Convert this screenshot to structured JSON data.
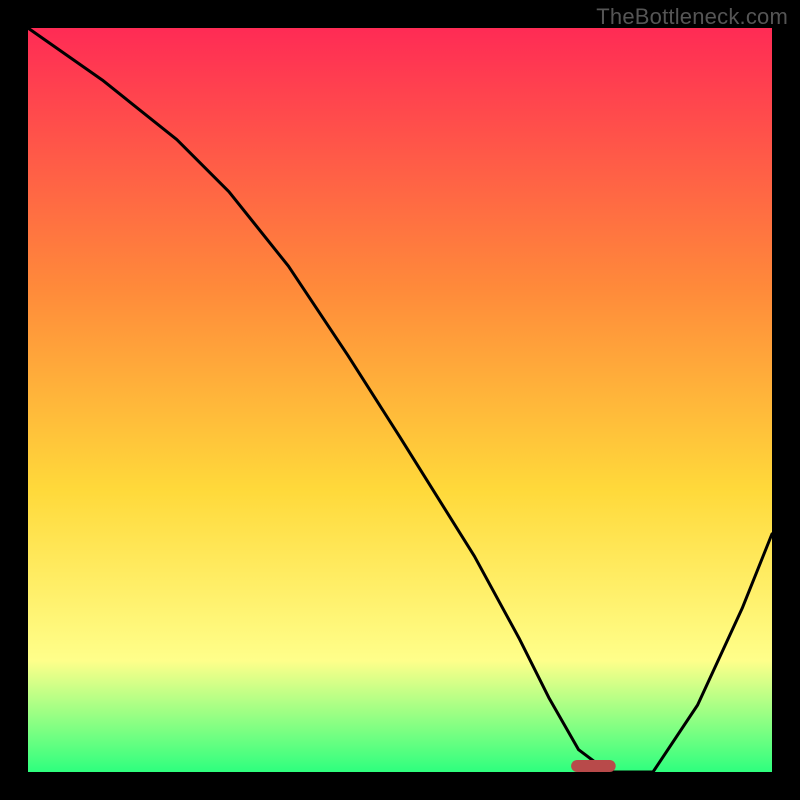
{
  "watermark": "TheBottleneck.com",
  "colors": {
    "gradient_top": "#ff2b55",
    "gradient_mid1": "#ff8a3a",
    "gradient_mid2": "#ffd93a",
    "gradient_mid3": "#ffff8a",
    "gradient_bottom": "#2eff7e",
    "curve": "#000000",
    "frame": "#000000",
    "marker": "#b84a4a"
  },
  "chart_data": {
    "type": "line",
    "title": "",
    "xlabel": "",
    "ylabel": "",
    "xlim": [
      0,
      100
    ],
    "ylim": [
      0,
      100
    ],
    "x": [
      0,
      10,
      20,
      27,
      35,
      43,
      50,
      55,
      60,
      66,
      70,
      74,
      78,
      84,
      90,
      96,
      100
    ],
    "values": [
      100,
      93,
      85,
      78,
      68,
      56,
      45,
      37,
      29,
      18,
      10,
      3,
      0,
      0,
      9,
      22,
      32
    ],
    "marker": {
      "x_center": 76,
      "width": 6,
      "y": 0.8
    }
  }
}
